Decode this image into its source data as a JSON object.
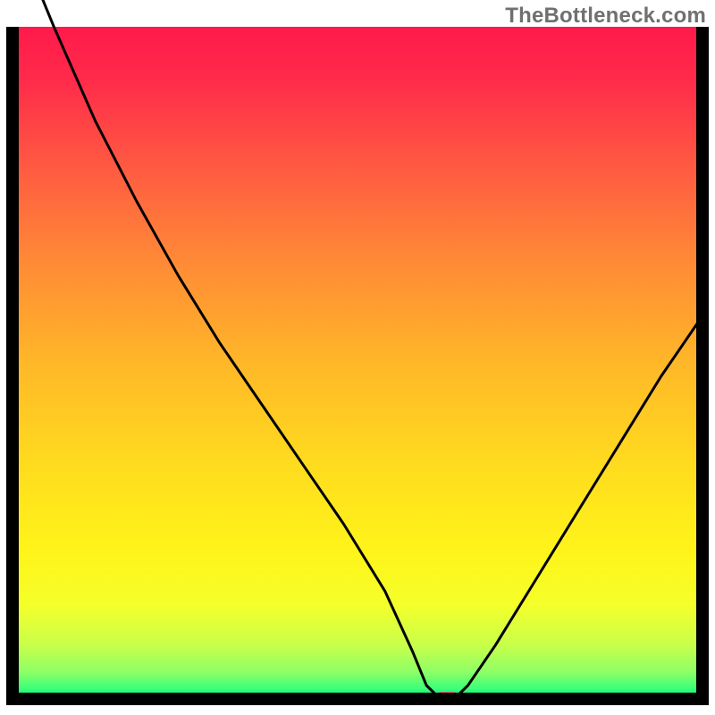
{
  "watermark": "TheBottleneck.com",
  "chart_data": {
    "type": "line",
    "title": "",
    "xlabel": "",
    "ylabel": "",
    "xlim": [
      0,
      100
    ],
    "ylim": [
      0,
      100
    ],
    "notes": "Bottleneck curve over a red→green vertical gradient background. Lower (green) is better; the curve reaches ~0 around x≈62. A small red-pink marker highlights the minimum. Axes are unlabeled and a black border frames the plot area.",
    "series": [
      {
        "name": "bottleneck-curve",
        "x": [
          0,
          6,
          12,
          18,
          24,
          30,
          36,
          42,
          48,
          54,
          58,
          60,
          62,
          64,
          66,
          70,
          76,
          82,
          88,
          94,
          100
        ],
        "values": [
          115,
          100,
          86,
          74,
          63,
          53,
          44,
          35,
          26,
          16,
          7,
          2,
          0,
          0,
          2,
          8,
          18,
          28,
          38,
          48,
          57
        ]
      }
    ],
    "marker": {
      "x": 63,
      "y": 0,
      "color": "#d66a6a"
    },
    "gradient_stops": [
      {
        "offset": 0.0,
        "color": "#ff1a4b"
      },
      {
        "offset": 0.08,
        "color": "#ff2b4a"
      },
      {
        "offset": 0.2,
        "color": "#ff5742"
      },
      {
        "offset": 0.35,
        "color": "#ff8a36"
      },
      {
        "offset": 0.5,
        "color": "#ffb728"
      },
      {
        "offset": 0.65,
        "color": "#ffdb1e"
      },
      {
        "offset": 0.78,
        "color": "#fff41a"
      },
      {
        "offset": 0.86,
        "color": "#f5ff2a"
      },
      {
        "offset": 0.92,
        "color": "#c8ff4a"
      },
      {
        "offset": 0.96,
        "color": "#8dff66"
      },
      {
        "offset": 0.985,
        "color": "#3aff7a"
      },
      {
        "offset": 1.0,
        "color": "#00e572"
      }
    ]
  }
}
